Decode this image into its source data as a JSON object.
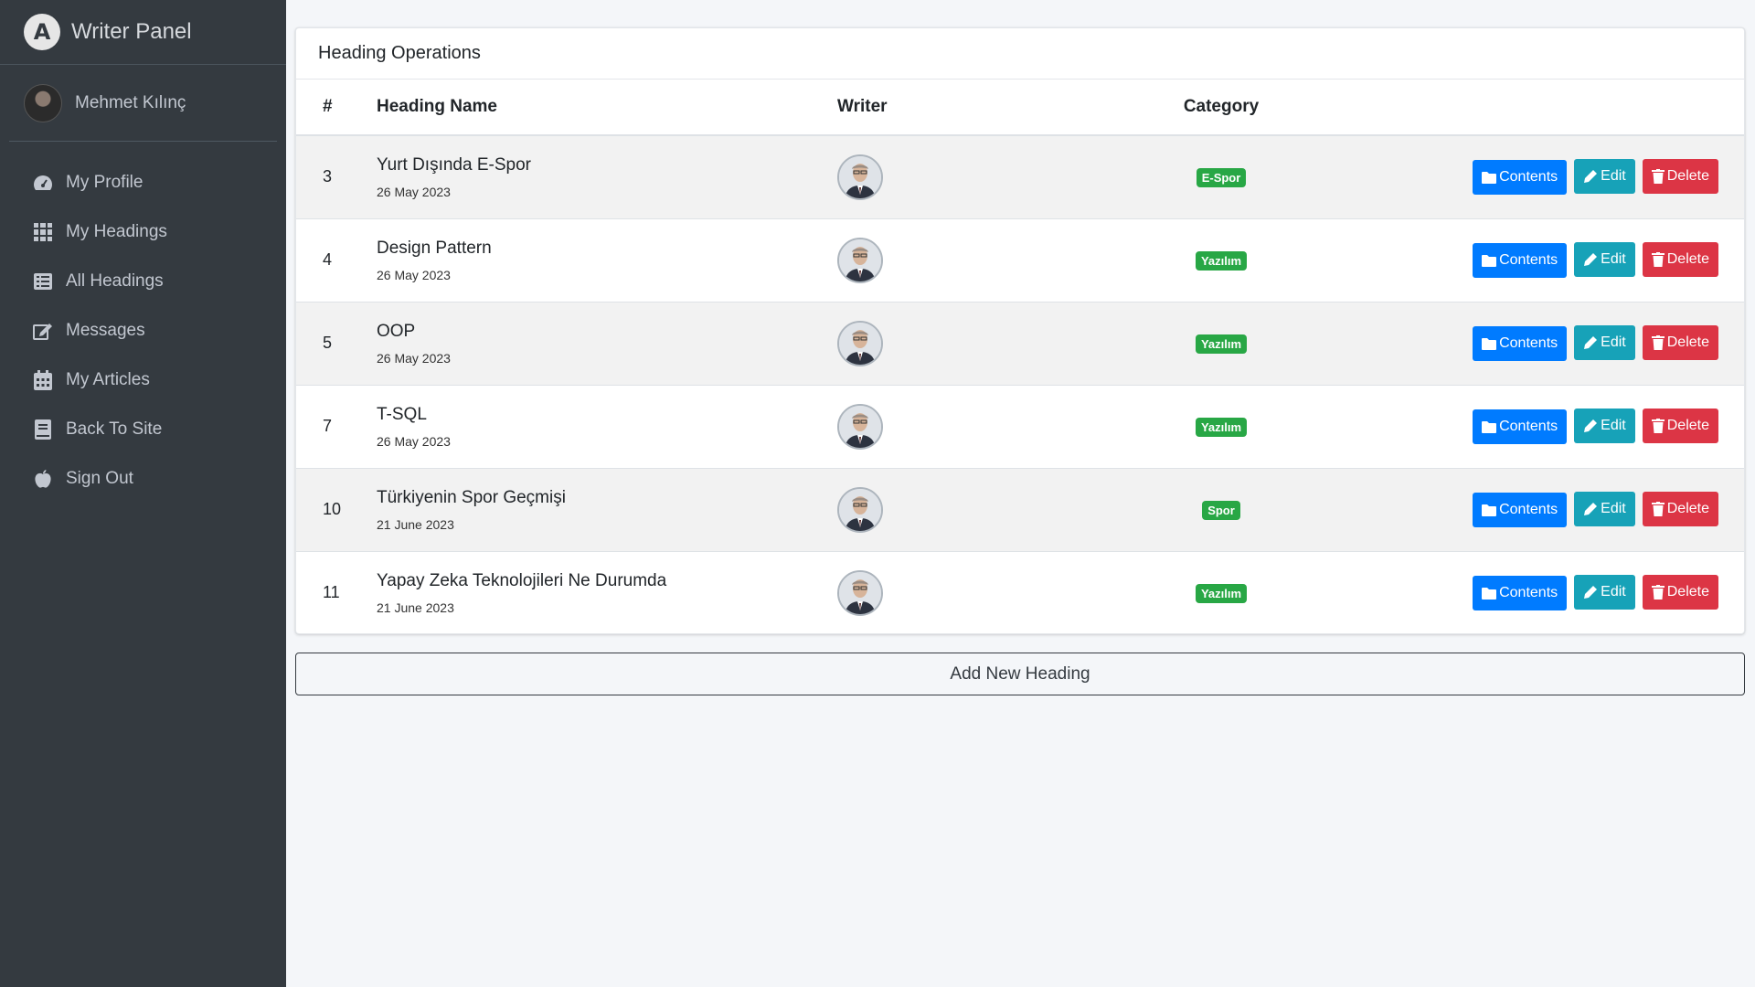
{
  "brand": {
    "logo_letter": "A",
    "title": "Writer Panel"
  },
  "user": {
    "name": "Mehmet Kılınç"
  },
  "nav": [
    {
      "label": "My Profile",
      "icon": "tachometer-icon"
    },
    {
      "label": "My Headings",
      "icon": "grid-icon"
    },
    {
      "label": "All Headings",
      "icon": "list-icon"
    },
    {
      "label": "Messages",
      "icon": "edit-icon"
    },
    {
      "label": "My Articles",
      "icon": "calendar-icon"
    },
    {
      "label": "Back To Site",
      "icon": "book-icon"
    },
    {
      "label": "Sign Out",
      "icon": "apple-icon"
    }
  ],
  "card": {
    "title": "Heading Operations"
  },
  "table": {
    "headers": {
      "id": "#",
      "name": "Heading Name",
      "writer": "Writer",
      "category": "Category"
    },
    "rows": [
      {
        "id": "3",
        "name": "Yurt Dışında E-Spor",
        "date": "26 May 2023",
        "category": "E-Spor"
      },
      {
        "id": "4",
        "name": "Design Pattern",
        "date": "26 May 2023",
        "category": "Yazılım"
      },
      {
        "id": "5",
        "name": "OOP",
        "date": "26 May 2023",
        "category": "Yazılım"
      },
      {
        "id": "7",
        "name": "T-SQL",
        "date": "26 May 2023",
        "category": "Yazılım"
      },
      {
        "id": "10",
        "name": "Türkiyenin Spor Geçmişi",
        "date": "21 June 2023",
        "category": "Spor"
      },
      {
        "id": "11",
        "name": "Yapay Zeka Teknolojileri Ne Durumda",
        "date": "21 June 2023",
        "category": "Yazılım"
      }
    ]
  },
  "buttons": {
    "contents": "Contents",
    "edit": "Edit",
    "delete": "Delete"
  },
  "add_button": "Add New Heading",
  "colors": {
    "sidebar": "#343a40",
    "primary": "#007bff",
    "info": "#17a2b8",
    "danger": "#dc3545",
    "success": "#28a745"
  }
}
